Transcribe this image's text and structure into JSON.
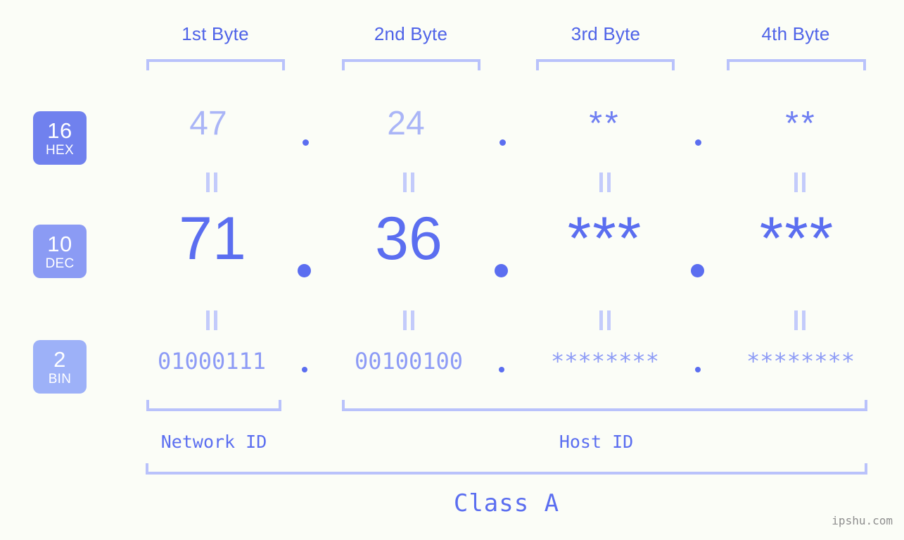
{
  "background_color": "#fbfdf7",
  "accent_colors": {
    "strong_blue": "#5b6ef0",
    "mid_blue": "#6e7ef2",
    "light_blue": "#8d9bf6",
    "pale_blue": "#aab5f7",
    "bracket_blue": "#b9c2fb",
    "badge_hex": "#7081ee",
    "badge_dec": "#8b9bf4",
    "badge_bin": "#9db1f8",
    "watermark_gray": "#8e8e8e"
  },
  "header": {
    "byte_labels": [
      "1st Byte",
      "2nd Byte",
      "3rd Byte",
      "4th Byte"
    ]
  },
  "rows": [
    {
      "base_number": "16",
      "base_name": "HEX",
      "values": [
        "47",
        "24",
        "**",
        "**"
      ],
      "separator": "."
    },
    {
      "base_number": "10",
      "base_name": "DEC",
      "values": [
        "71",
        "36",
        "***",
        "***"
      ],
      "separator": "."
    },
    {
      "base_number": "2",
      "base_name": "BIN",
      "values": [
        "01000111",
        "00100100",
        "********",
        "********"
      ],
      "separator": "."
    }
  ],
  "equals_symbol": "=",
  "footer": {
    "network_id_label": "Network ID",
    "host_id_label": "Host ID",
    "class_label": "Class A"
  },
  "watermark": "ipshu.com"
}
